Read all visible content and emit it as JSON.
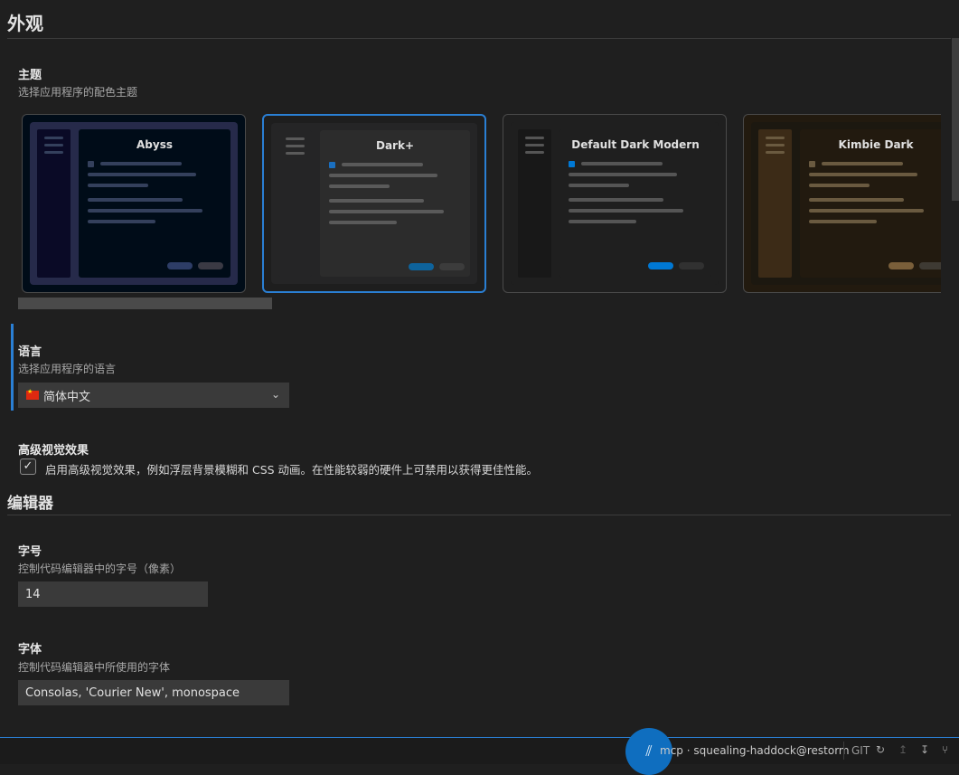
{
  "appearance": {
    "title": "外观",
    "theme": {
      "title": "主题",
      "desc": "选择应用程序的配色主题",
      "cards": [
        {
          "name": "Abyss",
          "bg": "#000c18",
          "frame": "#262a4a",
          "side": "#0a0a26",
          "main": "#000c18",
          "line": "#34405c",
          "dot": "#34405c",
          "btn1": "#2d3d66",
          "btn2": "#3a3a44",
          "selected": false
        },
        {
          "name": "Dark+",
          "bg": "#1e1e1e",
          "frame": "#252526",
          "side": "#252526",
          "main": "#2c2c2c",
          "line": "#5a5a5a",
          "dot": "#1a6fc0",
          "btn1": "#0e639c",
          "btn2": "#3c3c3c",
          "selected": true
        },
        {
          "name": "Default Dark Modern",
          "bg": "#1f1f1f",
          "frame": "#1f1f1f",
          "side": "#181818",
          "main": "#1f1f1f",
          "line": "#555555",
          "dot": "#0078d4",
          "btn1": "#0078d4",
          "btn2": "#313131",
          "selected": false
        },
        {
          "name": "Kimbie Dark",
          "bg": "#221a0f",
          "frame": "#1c1810",
          "side": "#3c2b17",
          "main": "#221a0f",
          "line": "#6a5a40",
          "dot": "#6a5a40",
          "btn1": "#7a5f3a",
          "btn2": "#3e3a33",
          "selected": false
        }
      ]
    },
    "language": {
      "title": "语言",
      "desc": "选择应用程序的语言",
      "selected": "简体中文"
    },
    "visual_effects": {
      "title": "高级视觉效果",
      "checked": true,
      "label": "启用高级视觉效果，例如浮层背景模糊和 CSS 动画。在性能较弱的硬件上可禁用以获得更佳性能。"
    }
  },
  "editor": {
    "title": "编辑器",
    "font_size": {
      "title": "字号",
      "desc": "控制代码编辑器中的字号（像素）",
      "value": "14"
    },
    "font_family": {
      "title": "字体",
      "desc": "控制代码编辑器中所使用的字体",
      "value": "Consolas, 'Courier New', monospace"
    }
  },
  "statusbar": {
    "remote": "mcp · squealing-haddock@restorm",
    "git_label": "GIT",
    "accent": "#2a7fd4"
  }
}
